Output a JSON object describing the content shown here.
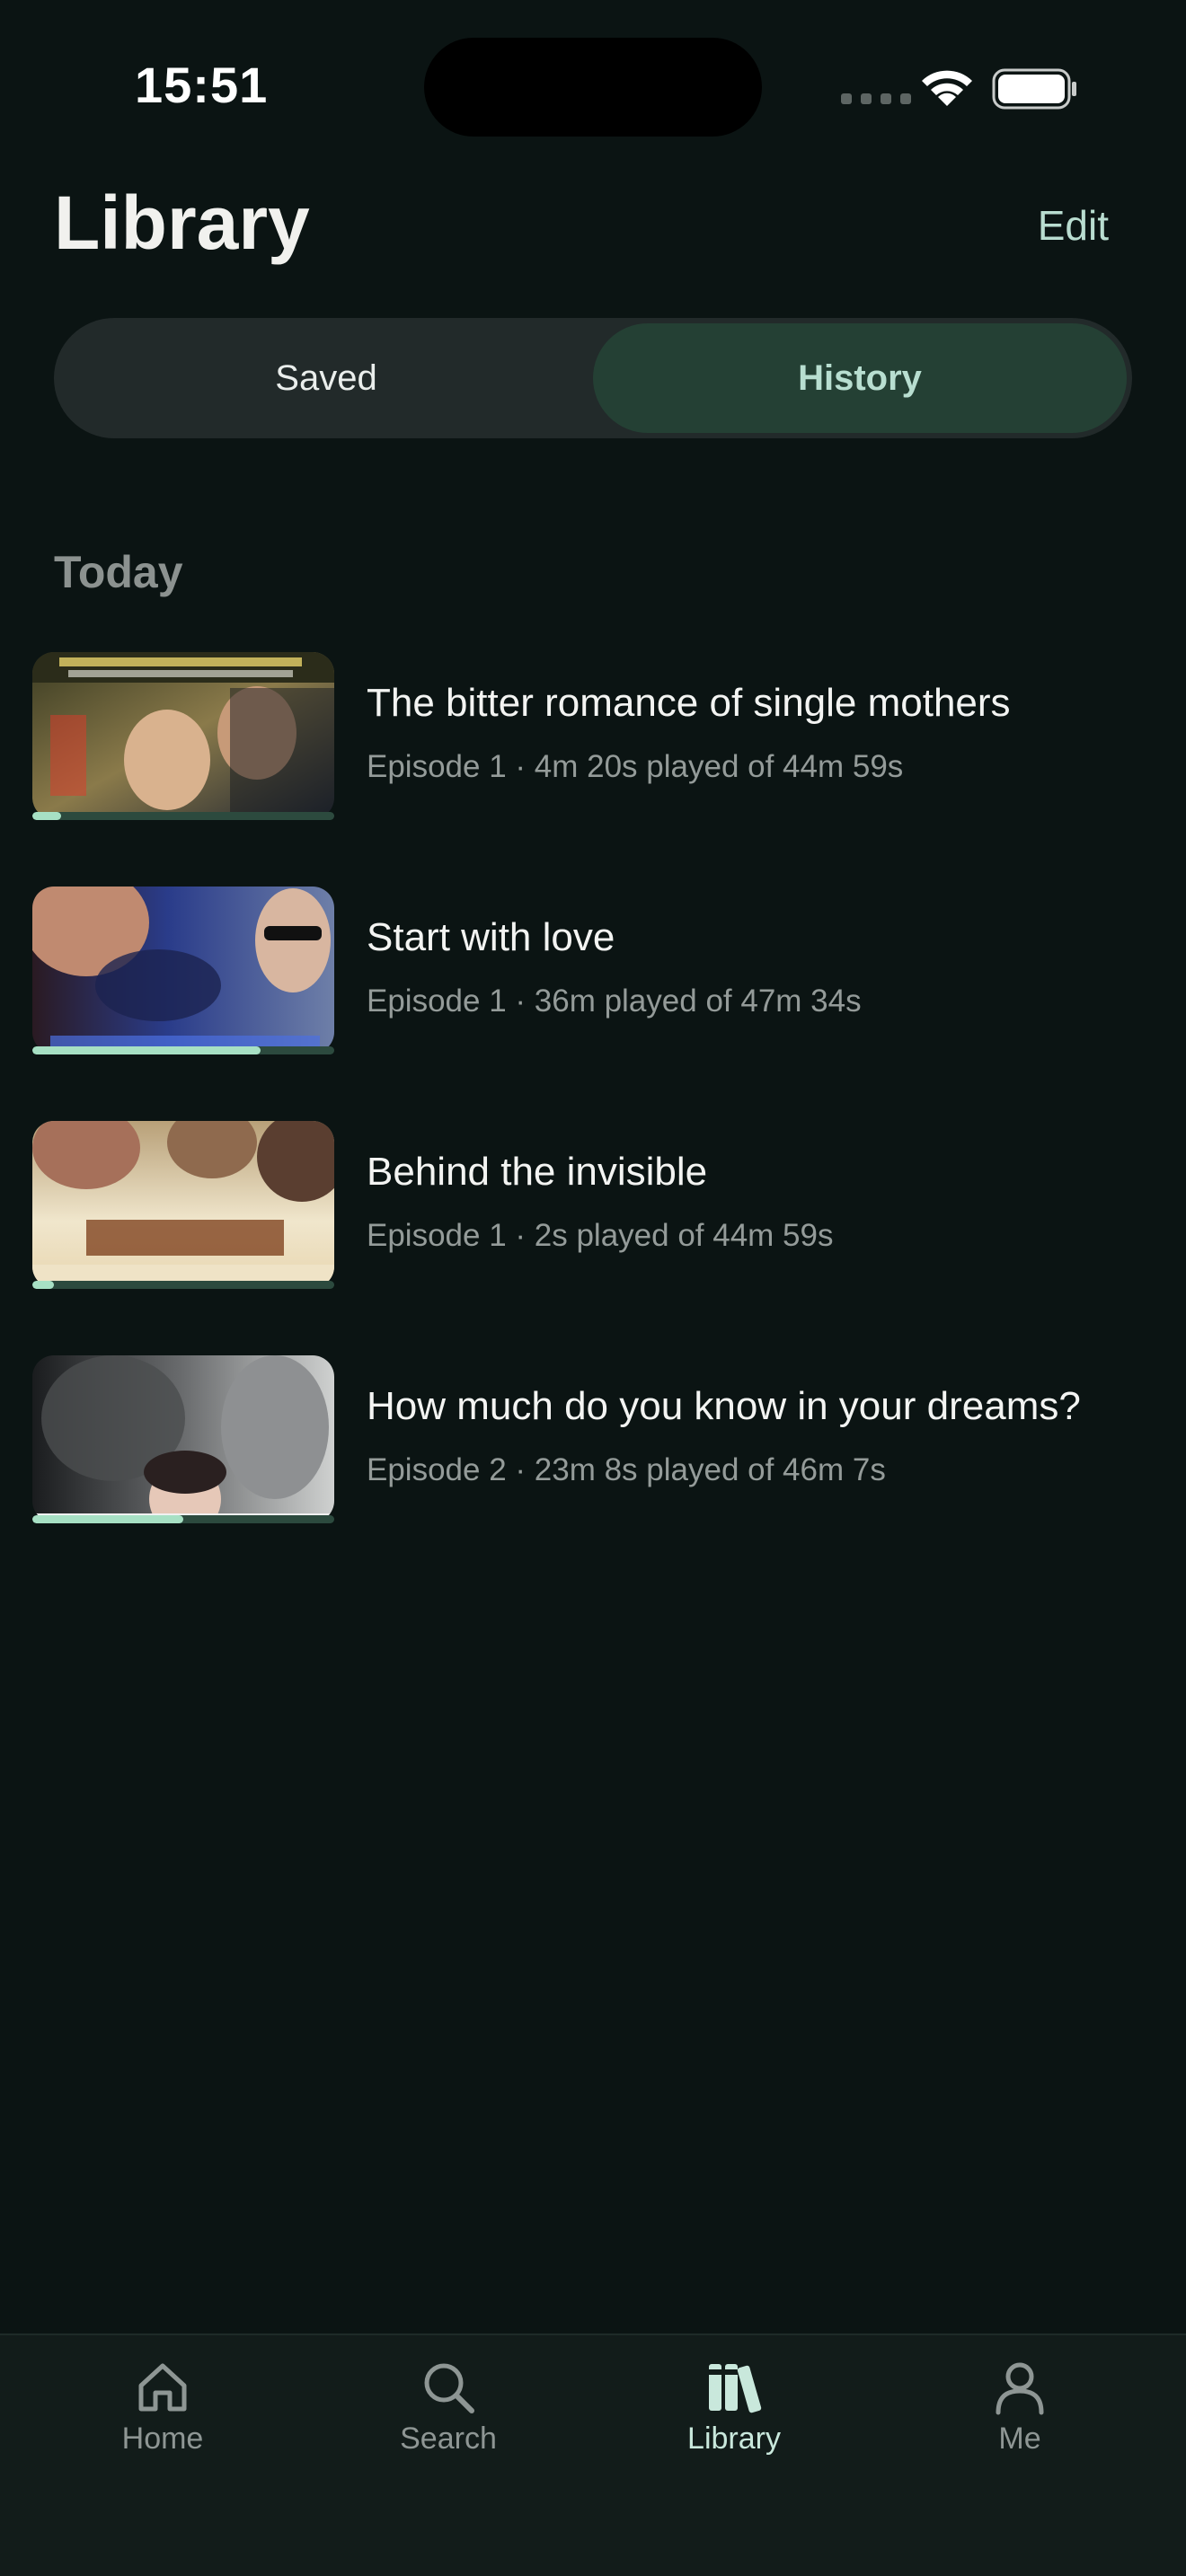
{
  "status_bar": {
    "time": "15:51"
  },
  "header": {
    "title": "Library",
    "edit_label": "Edit"
  },
  "segmented_control": {
    "options": [
      "Saved",
      "History"
    ],
    "selected": "History"
  },
  "section": {
    "title": "Today"
  },
  "history": [
    {
      "title": "The bitter romance of single mothers",
      "subtitle": "Episode 1 · 4m 20s played of 44m 59s",
      "progress": 0.096
    },
    {
      "title": "Start with love",
      "subtitle": "Episode 1 · 36m played of 47m 34s",
      "progress": 0.757
    },
    {
      "title": "Behind the invisible",
      "subtitle": "Episode 1 · 2s played of 44m 59s",
      "progress": 0.07
    },
    {
      "title": "How much do you know in your dreams?",
      "subtitle": "Episode 2 · 23m 8s played of 46m 7s",
      "progress": 0.5
    }
  ],
  "tab_bar": {
    "items": [
      {
        "label": "Home",
        "icon": "home-icon"
      },
      {
        "label": "Search",
        "icon": "search-icon"
      },
      {
        "label": "Library",
        "icon": "library-icon"
      },
      {
        "label": "Me",
        "icon": "person-icon"
      }
    ],
    "active": "Library"
  },
  "colors": {
    "background": "#0b1413",
    "accent": "#a7e0c4",
    "segment_active": "#244034",
    "edit": "#b9ddd0"
  }
}
